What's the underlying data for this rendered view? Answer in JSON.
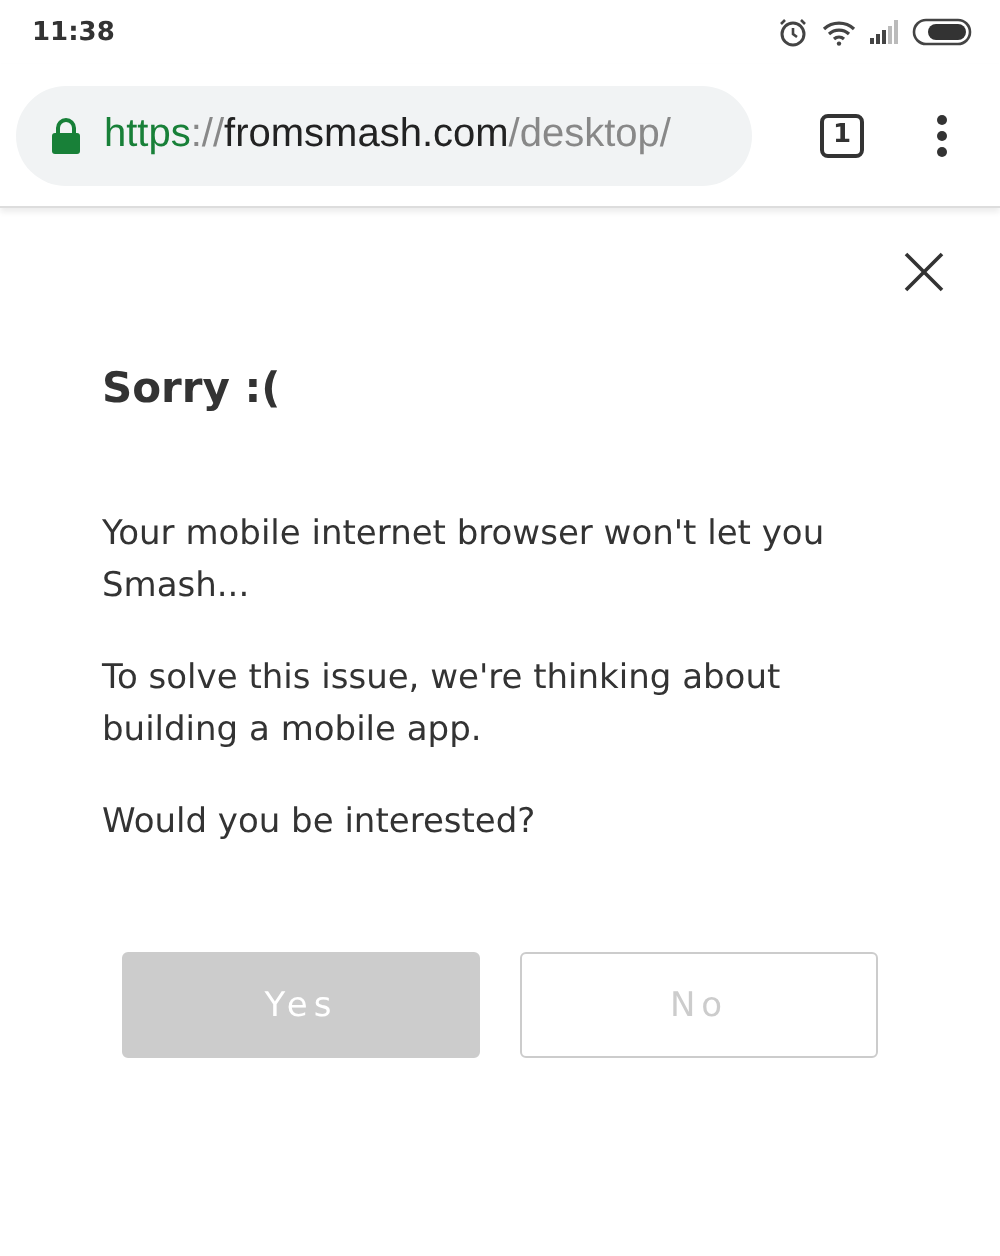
{
  "status_bar": {
    "time": "11:38"
  },
  "browser": {
    "url_parts": [
      {
        "kind": "scheme",
        "text": "https"
      },
      {
        "kind": "sep",
        "text": "://"
      },
      {
        "kind": "host",
        "text": "fromsmash.com"
      },
      {
        "kind": "path",
        "text": "/desktop/"
      }
    ],
    "tab_count": "1"
  },
  "dialog": {
    "title": "Sorry :(",
    "paragraphs": [
      "Your mobile internet browser won't let you Smash...",
      "To solve this issue, we're thinking about building a mobile app.",
      "Would you be interested?"
    ],
    "buttons": [
      {
        "kind": "filled",
        "label": "Yes"
      },
      {
        "kind": "outline",
        "label": "No"
      }
    ]
  }
}
